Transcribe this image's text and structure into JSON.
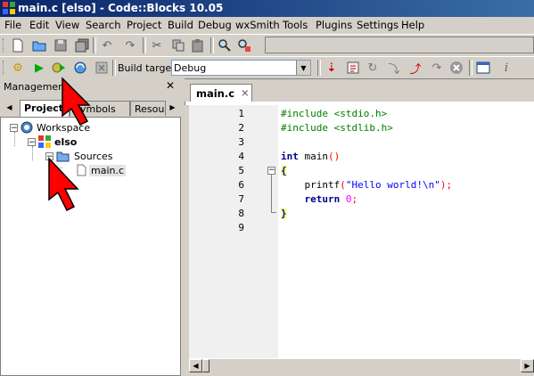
{
  "window": {
    "title": "main.c [elso] - Code::Blocks 10.05"
  },
  "menu": [
    "File",
    "Edit",
    "View",
    "Search",
    "Project",
    "Build",
    "Debug",
    "wxSmith",
    "Tools",
    "Plugins",
    "Settings",
    "Help"
  ],
  "build_toolbar": {
    "target_label": "Build target:",
    "target_value": "Debug"
  },
  "management": {
    "title": "Management",
    "close_glyph": "✕",
    "tabs": [
      "Projects",
      "Symbols",
      "Resou"
    ],
    "tree": {
      "workspace": "Workspace",
      "project": "elso",
      "folder": "Sources",
      "file": "main.c"
    }
  },
  "editor": {
    "tab_label": "main.c",
    "tab_close_glyph": "×",
    "line_numbers": [
      "1",
      "2",
      "3",
      "4",
      "5",
      "6",
      "7",
      "8",
      "9"
    ],
    "lines": [
      {
        "pp": "#include <stdio.h>"
      },
      {
        "pp": "#include <stdlib.h>"
      },
      {},
      {
        "kw": "int",
        "rest": " main",
        "br": "()"
      },
      {
        "br": "{"
      },
      {
        "indent": "    ",
        "rest": "printf",
        "br": "(",
        "str": "\"Hello world!\\n\"",
        "br2": ");"
      },
      {
        "indent": "    ",
        "kw": "return",
        "rest": " ",
        "num": "0",
        "semi": ";"
      },
      {
        "br": "}"
      },
      {}
    ]
  },
  "colors": {
    "title_bar": "#0a246a",
    "annotation_arrow": "#ff0000"
  }
}
